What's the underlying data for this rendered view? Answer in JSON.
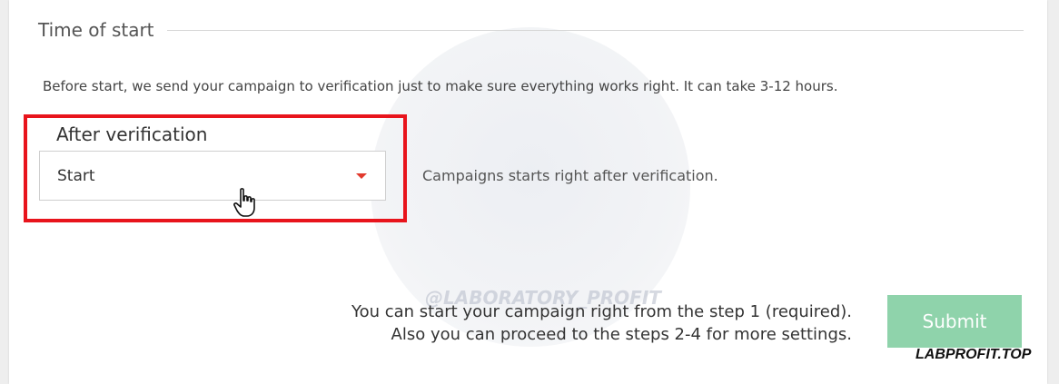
{
  "section": {
    "title": "Time of start",
    "note": "Before start, we send your campaign to verification just to make sure everything works right. It can take 3-12 hours."
  },
  "start_mode": {
    "label": "After verification",
    "selected": "Start",
    "help": "Campaigns starts right after verification."
  },
  "footer": {
    "info_line1": "You can start your campaign right from the step 1 (required).",
    "info_line2": "Also you can proceed to the steps 2-4 for more settings.",
    "submit_label": "Submit"
  },
  "overlay": {
    "watermark": "@LABORATORY_PROFIT",
    "site_mark": "LABPROFIT.TOP"
  },
  "colors": {
    "accent_red": "#e8141c",
    "caret": "#e23a2d",
    "submit_bg": "#8fd3ab"
  },
  "icons": {
    "caret": "caret-down-icon",
    "cursor": "hand-pointer-icon"
  }
}
